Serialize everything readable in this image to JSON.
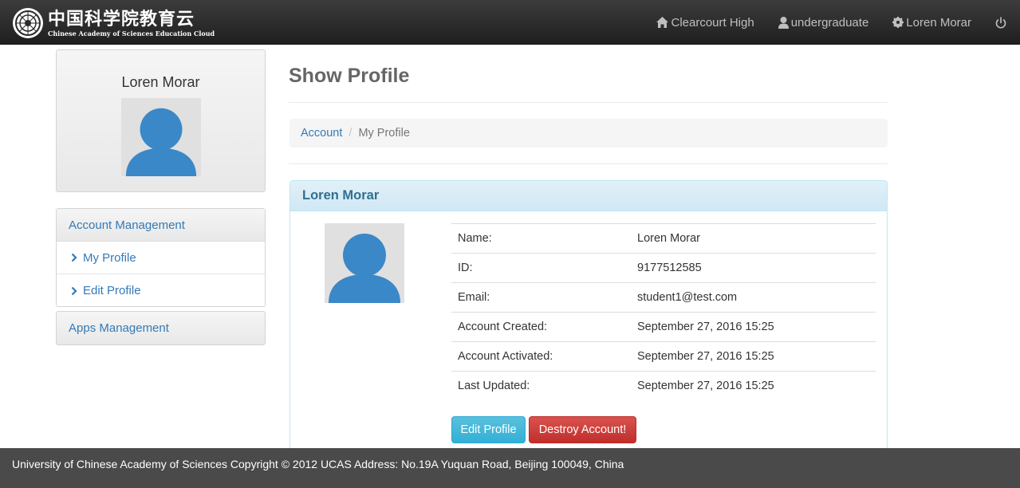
{
  "brand": {
    "title_cn": "中国科学院教育云",
    "title_en": "Chinese Academy of Sciences Education Cloud"
  },
  "navbar": {
    "school": "Clearcourt High",
    "role": "undergraduate",
    "user": "Loren Morar",
    "icons": [
      "home-icon",
      "user-icon",
      "gear-icon",
      "power-icon"
    ]
  },
  "sidebar": {
    "profile_name": "Loren Morar",
    "account_management": {
      "heading": "Account Management",
      "items": [
        {
          "label": "My Profile"
        },
        {
          "label": "Edit Profile"
        }
      ]
    },
    "apps_management": "Apps Management"
  },
  "main": {
    "title": "Show Profile",
    "breadcrumb": {
      "items": [
        "Account",
        "My Profile"
      ],
      "separator": "/"
    },
    "panel": {
      "title": "Loren Morar",
      "rows": [
        {
          "label": "Name:",
          "value": "Loren Morar"
        },
        {
          "label": "ID:",
          "value": "9177512585"
        },
        {
          "label": "Email:",
          "value": "student1@test.com"
        },
        {
          "label": "Account Created:",
          "value": "September 27, 2016 15:25"
        },
        {
          "label": "Account Activated:",
          "value": "September 27, 2016 15:25"
        },
        {
          "label": "Last Updated:",
          "value": "September 27, 2016 15:25"
        }
      ],
      "buttons": {
        "edit": "Edit Profile",
        "destroy": "Destroy Account!"
      }
    }
  },
  "footer": {
    "text": "University of Chinese Academy of Sciences Copyright © 2012 UCAS Address: No.19A Yuquan Road, Beijing 100049, China"
  },
  "colors": {
    "link": "#337ab7",
    "avatar": "#3a88c8",
    "info_button": "#5bc0de",
    "danger_button": "#d9534f",
    "panel_heading_text": "#31708f"
  }
}
